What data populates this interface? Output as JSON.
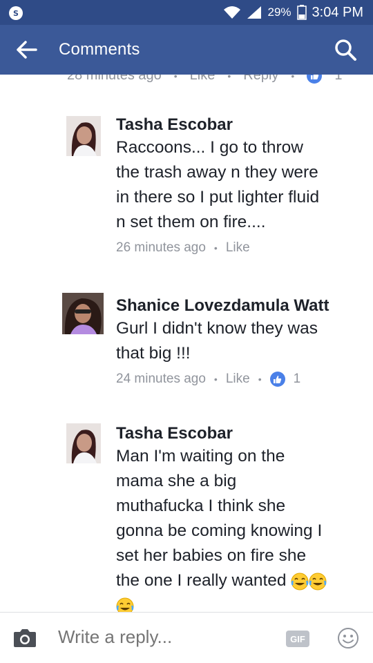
{
  "status_bar": {
    "battery": "29%",
    "time": "3:04 PM"
  },
  "app_bar": {
    "title": "Comments"
  },
  "partial_comment": {
    "time": "28 minutes ago",
    "like": "Like",
    "reply": "Reply",
    "like_count": "1"
  },
  "comments": [
    {
      "author": "Tasha Escobar",
      "text": "Raccoons... I go to throw\nthe trash away n they were\nin  there so I put lighter fluid\nn set them on fire....",
      "time": "26 minutes ago",
      "like": "Like"
    },
    {
      "author": "Shanice Lovezdamula Watt",
      "text": "Gurl I didn't know they was\nthat big !!!",
      "time": "24 minutes ago",
      "like": "Like",
      "like_count": "1"
    },
    {
      "author": "Tasha Escobar",
      "text": "Man I'm waiting on the\nmama she a big\nmuthafucka I think she\ngonna be coming knowing I\nset her babies on fire she\nthe one I really wanted",
      "emojis": [
        "face-with-tears-of-joy-icon",
        "face-with-tears-of-joy-icon",
        "face-with-tears-of-joy-icon"
      ]
    }
  ],
  "reply_bar": {
    "placeholder": "Write a reply...",
    "gif_label": "GIF"
  },
  "colors": {
    "status_bar": "#2f4b87",
    "app_bar": "#3b5998",
    "meta_text": "#90949c",
    "like_badge": "#4a80e8"
  }
}
